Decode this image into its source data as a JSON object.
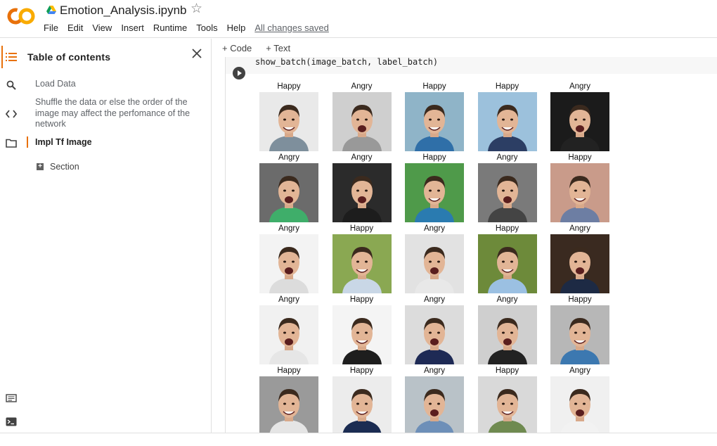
{
  "header": {
    "title": "Emotion_Analysis.ipynb",
    "menu": [
      "File",
      "Edit",
      "View",
      "Insert",
      "Runtime",
      "Tools",
      "Help"
    ],
    "saved_status": "All changes saved"
  },
  "toc": {
    "title": "Table of contents",
    "items": [
      {
        "label": "Load Data"
      },
      {
        "label": "Shuffle the data or else the order of the image may affect the perfomance of the network"
      },
      {
        "label": "Impl Tf Image"
      }
    ],
    "section_label": "Section"
  },
  "toolbar": {
    "code_label": "+ Code",
    "text_label": "+ Text"
  },
  "cell": {
    "code": "show_batch(image_batch, label_batch)"
  },
  "labels": [
    "Happy",
    "Angry",
    "Happy",
    "Happy",
    "Angry",
    "Angry",
    "Angry",
    "Happy",
    "Angry",
    "Happy",
    "Angry",
    "Happy",
    "Angry",
    "Happy",
    "Angry",
    "Angry",
    "Happy",
    "Angry",
    "Angry",
    "Happy",
    "Happy",
    "Happy",
    "Angry",
    "Happy",
    "Angry"
  ],
  "icons": {
    "rail": [
      "toc-icon",
      "search-icon",
      "code-snippets-icon",
      "folder-icon"
    ],
    "rail_bottom": [
      "command-palette-icon",
      "terminal-icon"
    ]
  },
  "colors": {
    "accent": "#e8710a",
    "logo_orange": "#f9ab00"
  }
}
